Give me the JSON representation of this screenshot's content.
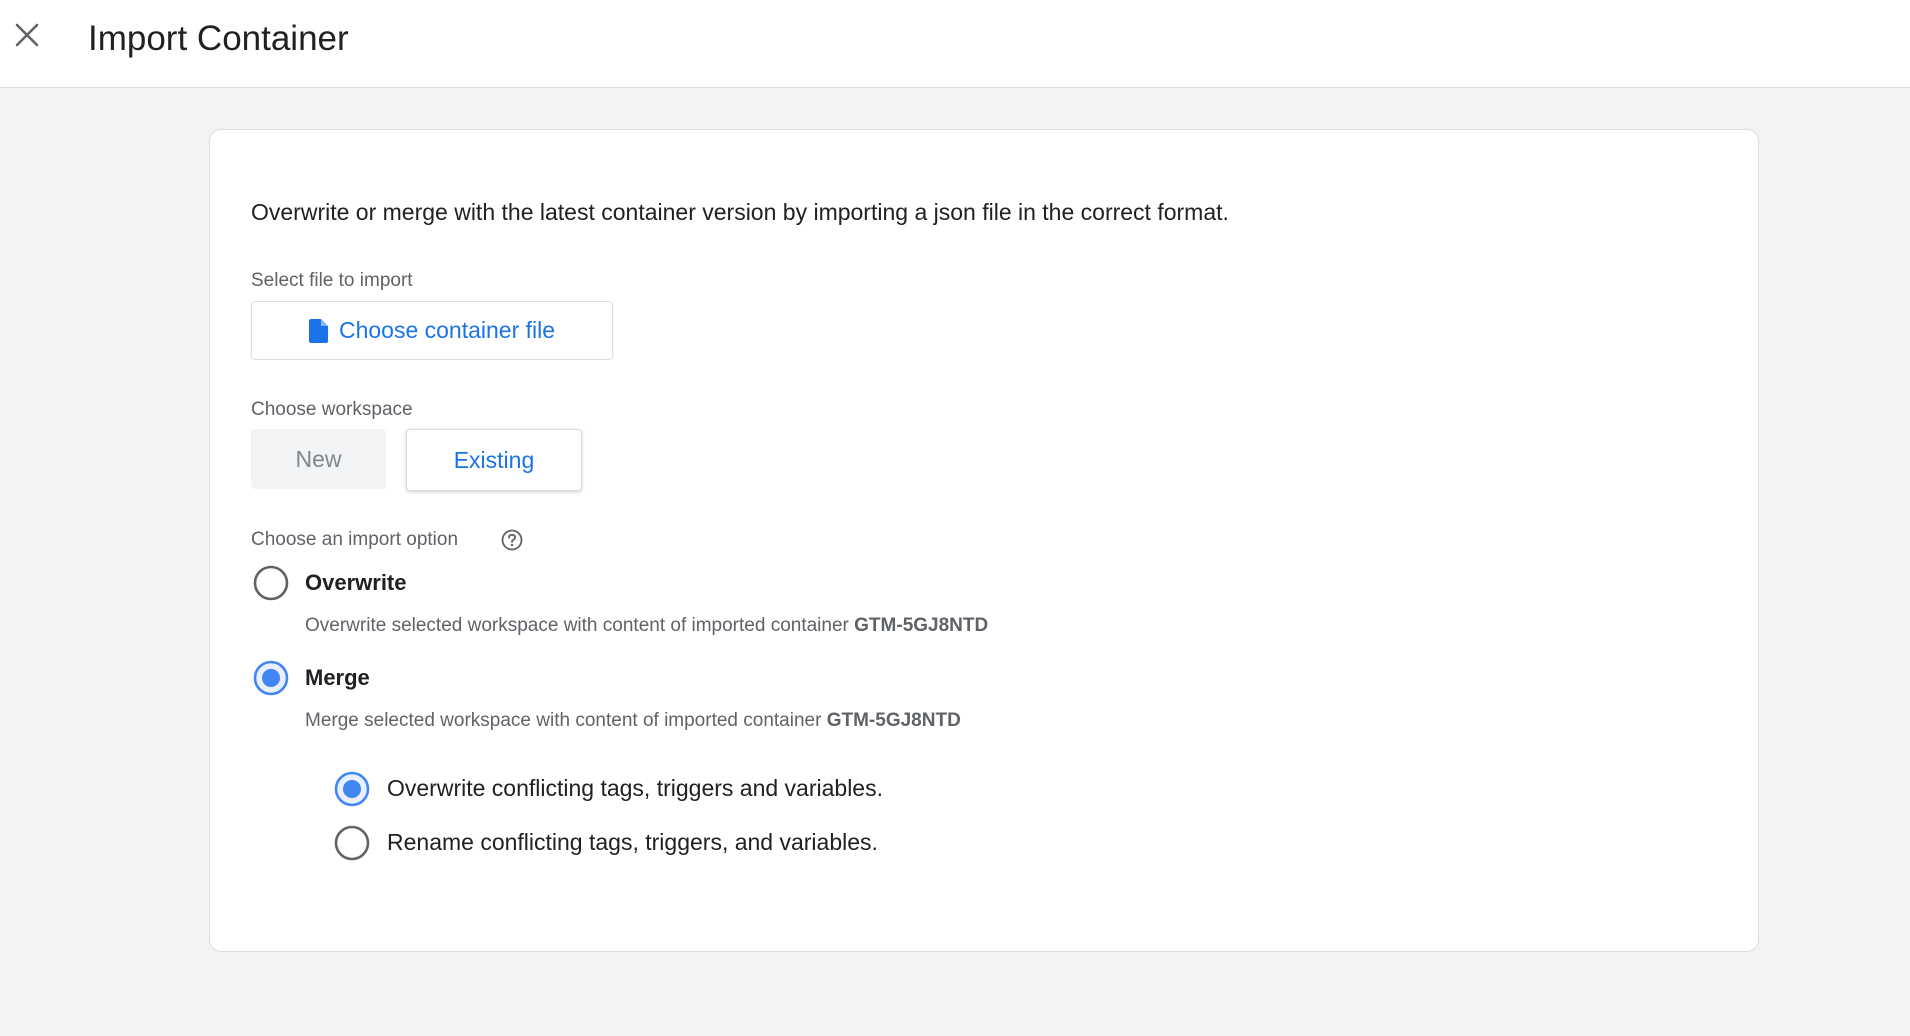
{
  "header": {
    "title": "Import Container",
    "close_icon": "close-icon"
  },
  "card": {
    "intro": "Overwrite or merge with the latest container version by importing a json file in the correct format.",
    "file_section": {
      "label": "Select file to import",
      "button_label": "Choose container file",
      "button_icon": "file-icon"
    },
    "workspace_section": {
      "label": "Choose workspace",
      "options": [
        "New",
        "Existing"
      ],
      "selected": "Existing"
    },
    "import_section": {
      "label": "Choose an import option",
      "help_icon": "help-icon",
      "options": [
        {
          "title": "Overwrite",
          "desc_prefix": "Overwrite selected workspace with content of imported container",
          "container_id": "GTM-5GJ8NTD",
          "selected": false
        },
        {
          "title": "Merge",
          "desc_prefix": "Merge selected workspace with content of imported container",
          "container_id": "GTM-5GJ8NTD",
          "selected": true
        }
      ],
      "merge_options": [
        {
          "label": "Overwrite conflicting tags, triggers and variables.",
          "selected": true
        },
        {
          "label": "Rename conflicting tags, triggers, and variables.",
          "selected": false
        }
      ]
    }
  },
  "colors": {
    "accent": "#1a73e8",
    "radio_selected": "#4285f4",
    "background": "#f1f3f4"
  }
}
